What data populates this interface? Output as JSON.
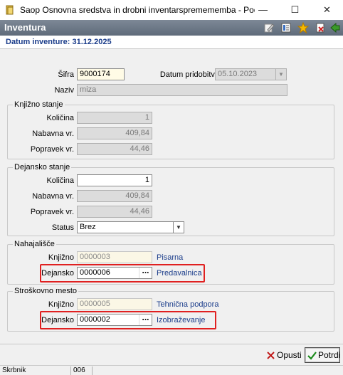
{
  "window": {
    "title": "Saop Osnovna sredstva in drobni inventarspremememba - Podjetje - T...",
    "minimize": "—",
    "maximize": "☐",
    "close": "✕"
  },
  "header": {
    "title": "Inventura",
    "toolbar_icons": [
      "edit-icon",
      "list-icon",
      "star-icon",
      "delete-icon",
      "export-icon"
    ]
  },
  "date_line": "Datum inventure: 31.12.2025",
  "basic": {
    "sifra_label": "Šifra",
    "sifra_value": "9000174",
    "datum_label": "Datum pridobitve",
    "datum_value": "05.10.2023",
    "naziv_label": "Naziv",
    "naziv_value": "miza"
  },
  "knjizno_stanje": {
    "title": "Knjižno stanje",
    "kolicina_label": "Količina",
    "kolicina_value": "1",
    "nabavna_label": "Nabavna vr.",
    "nabavna_value": "409,84",
    "popravek_label": "Popravek vr.",
    "popravek_value": "44,46"
  },
  "dejansko_stanje": {
    "title": "Dejansko stanje",
    "kolicina_label": "Količina",
    "kolicina_value": "1",
    "nabavna_label": "Nabavna vr.",
    "nabavna_value": "409,84",
    "popravek_label": "Popravek vr.",
    "popravek_value": "44,46",
    "status_label": "Status",
    "status_value": "Brez"
  },
  "nahajalisce": {
    "title": "Nahajališče",
    "knjizno_label": "Knjižno",
    "knjizno_code": "0000003",
    "knjizno_name": "Pisarna",
    "dejansko_label": "Dejansko",
    "dejansko_code": "0000006",
    "dejansko_name": "Predavalnica"
  },
  "stroskovno_mesto": {
    "title": "Stroškovno mesto",
    "knjizno_label": "Knjižno",
    "knjizno_code": "0000005",
    "knjizno_name": "Tehnična podpora",
    "dejansko_label": "Dejansko",
    "dejansko_code": "0000002",
    "dejansko_name": "Izobraževanje"
  },
  "buttons": {
    "cancel_label": "Opusti",
    "confirm_label": "Potrdi"
  },
  "status_bar": {
    "user": "Skrbnik",
    "code": "006"
  },
  "colors": {
    "accent": "#1a3c8a",
    "highlight": "#e02020",
    "header_bg": "#6b7786"
  }
}
